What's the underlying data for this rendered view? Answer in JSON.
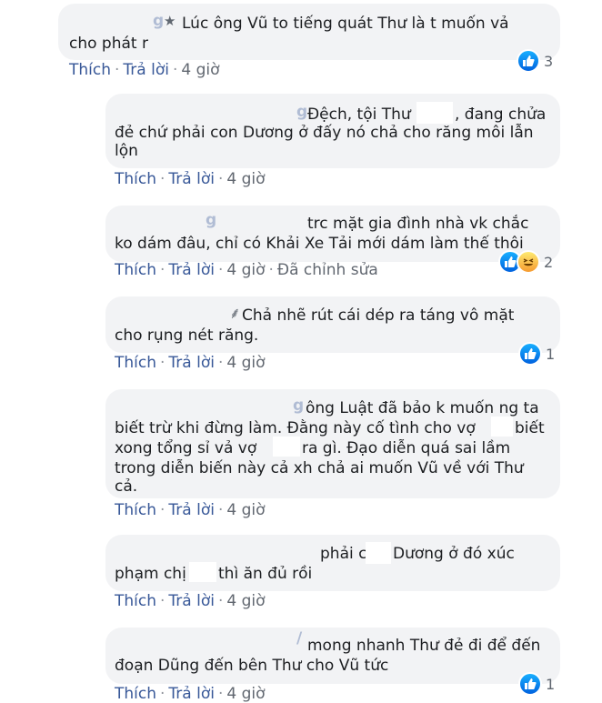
{
  "comments": [
    {
      "text_line1": "Lúc ông Vũ to tiếng quát Thư là t muốn vả",
      "text_line2": "cho phát r",
      "like": "Thích",
      "reply": "Trả lời",
      "time": "4 giờ",
      "reactions": "3"
    },
    {
      "text_line1": "Đệch, tội Thư",
      "text_line1b": ", đang chửa",
      "text_line2": "đẻ chứ phải con Dương ở đấy nó chả cho răng môi lẫn",
      "text_line3": "lộn",
      "like": "Thích",
      "reply": "Trả lời",
      "time": "4 giờ"
    },
    {
      "text_line1": "trc mặt gia đình nhà vk chắc",
      "text_line2": "ko dám đâu, chỉ có Khải Xe Tải mới dám làm thế thôi",
      "like": "Thích",
      "reply": "Trả lời",
      "time": "4 giờ",
      "edited": "Đã chỉnh sửa",
      "reactions": "2"
    },
    {
      "text_line1": "Chả nhẽ rút cái dép ra táng vô mặt",
      "text_line2": "cho rụng nét răng.",
      "like": "Thích",
      "reply": "Trả lời",
      "time": "4 giờ",
      "reactions": "1"
    },
    {
      "text_line1": "ông Luật đã bảo k muốn ng ta",
      "text_line2a": "biết trừ khi đừng làm. Đằng này cố tình cho vợ",
      "text_line2b": "biết",
      "text_line3a": "xong tổng sỉ vả vợ",
      "text_line3b": "ra gì. Đạo diễn quá sai lầm",
      "text_line4": "trong diễn biến này cả xh chả ai muốn Vũ về với Thư",
      "text_line5": "cả.",
      "like": "Thích",
      "reply": "Trả lời",
      "time": "4 giờ"
    },
    {
      "text_line1a": "phải c",
      "text_line1b": "Dương ở đó xúc",
      "text_line2a": "phạm chị",
      "text_line2b": "thì ăn đủ rồi",
      "like": "Thích",
      "reply": "Trả lời",
      "time": "4 giờ"
    },
    {
      "text_line1": "mong nhanh Thư đẻ đi để đến",
      "text_line2": "đoạn Dũng đến bên Thư cho Vũ tức",
      "like": "Thích",
      "reply": "Trả lời",
      "time": "4 giờ",
      "reactions": "1"
    }
  ],
  "colors": {
    "link": "#385898",
    "bubble": "#f2f3f5",
    "meta": "#616770"
  }
}
